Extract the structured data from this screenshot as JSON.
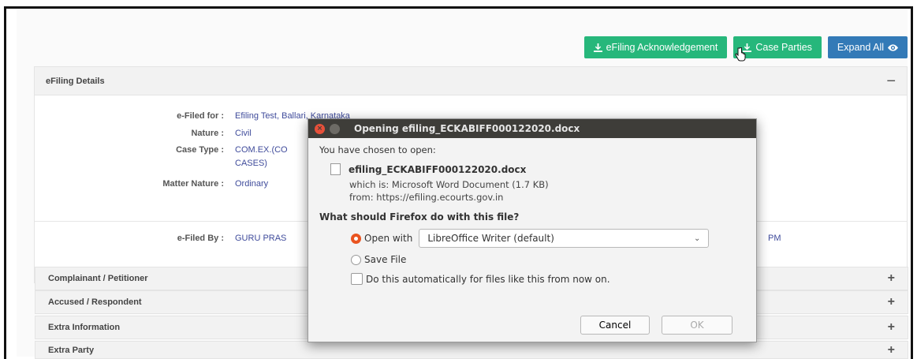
{
  "toolbar": {
    "ack_label": "eFiling Acknowledgement",
    "parties_label": "Case Parties",
    "expand_label": "Expand All"
  },
  "efiling_details": {
    "title": "eFiling Details",
    "rows": [
      {
        "label": "e-Filed for :",
        "value": "Efiling Test, Ballari, Karnataka"
      },
      {
        "label": "Nature :",
        "value": "Civil"
      },
      {
        "label": "Case Type :",
        "value": "COM.EX.(CO",
        "value2": "CASES)"
      },
      {
        "label": "Matter Nature :",
        "value": "Ordinary"
      }
    ],
    "filed_by_label": "e-Filed By :",
    "filed_by_value": "GURU PRAS",
    "filed_time_fragment": "PM"
  },
  "accordions": [
    {
      "title": "Complainant / Petitioner"
    },
    {
      "title": "Accused / Respondent"
    },
    {
      "title": "Extra Information"
    },
    {
      "title": "Extra Party"
    }
  ],
  "dialog": {
    "title": "Opening efiling_ECKABIFF000122020.docx",
    "intro": "You have chosen to open:",
    "filename": "efiling_ECKABIFF000122020.docx",
    "which_is": "which is: Microsoft Word Document (1.7 KB)",
    "from": "from: https://efiling.ecourts.gov.in",
    "question": "What should Firefox do with this file?",
    "open_with_label": "Open with",
    "open_with_app": "LibreOffice Writer (default)",
    "save_file_label": "Save File",
    "auto_label": "Do this automatically for files like this from now on.",
    "cancel_label": "Cancel",
    "ok_label": "OK"
  },
  "colors": {
    "green": "#26b77b",
    "blue": "#337ab7",
    "titlebar": "#3e3d39",
    "radio_accent": "#e95420"
  }
}
